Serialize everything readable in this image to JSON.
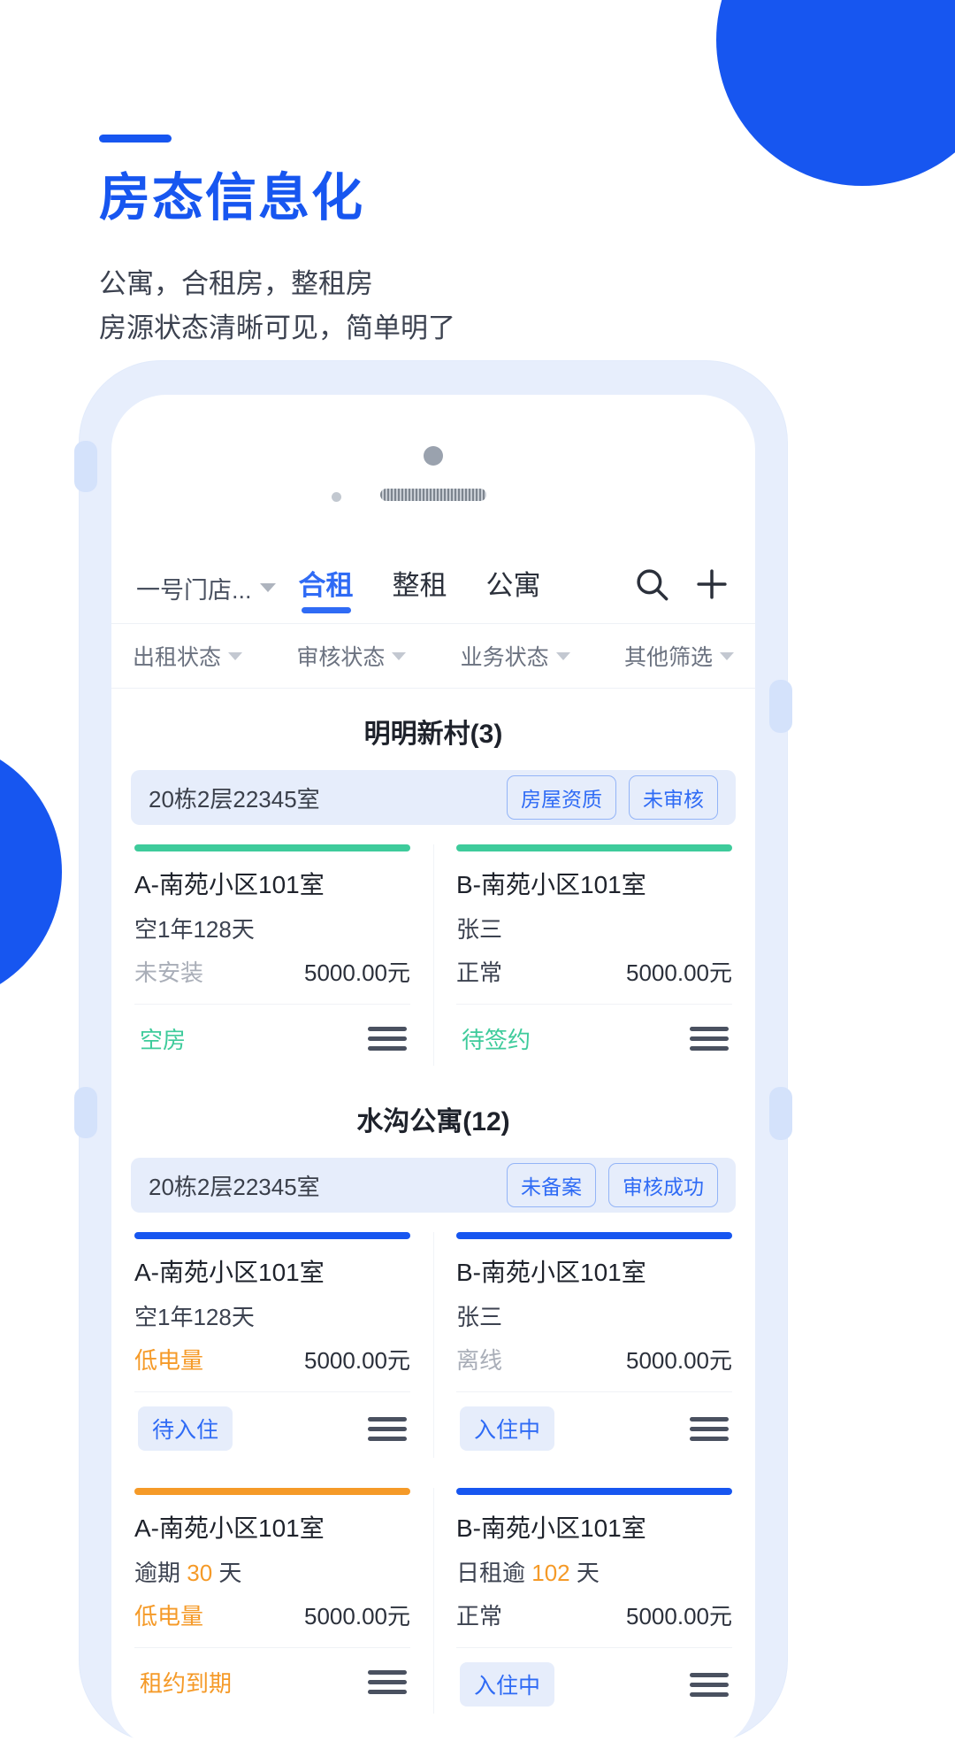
{
  "hero": {
    "title": "房态信息化",
    "subtitle_line1": "公寓，合租房，整租房",
    "subtitle_line2": "房源状态清晰可见，简单明了",
    "accent_color": "#1756f0"
  },
  "app": {
    "store_selector": "一号门店...",
    "tabs": [
      {
        "label": "合租",
        "active": true
      },
      {
        "label": "整租",
        "active": false
      },
      {
        "label": "公寓",
        "active": false
      }
    ],
    "icons": {
      "search": "search-icon",
      "add": "plus-icon"
    },
    "filters": [
      "出租状态",
      "审核状态",
      "业务状态",
      "其他筛选"
    ],
    "groups": [
      {
        "title": "明明新村(3)",
        "address": "20栋2层22345室",
        "address_badges": [
          "房屋资质",
          "未审核"
        ],
        "rows": [
          {
            "cells": [
              {
                "bar_color": "#3ecb9b",
                "title": "A-南苑小区101室",
                "meta": "空1年128天",
                "meta_highlight": "",
                "state": "未安装",
                "state_color": "#a9aeb8",
                "price": "5000.00元",
                "action_label": "空房",
                "action_color": "#3ecb9b",
                "action_style": "text"
              },
              {
                "bar_color": "#3ecb9b",
                "title": "B-南苑小区101室",
                "meta": "张三",
                "meta_highlight": "",
                "state": "正常",
                "state_color": "#3c4250",
                "price": "5000.00元",
                "action_label": "待签约",
                "action_color": "#3ecb9b",
                "action_style": "text"
              }
            ]
          }
        ]
      },
      {
        "title": "水沟公寓(12)",
        "address": "20栋2层22345室",
        "address_badges": [
          "未备案",
          "审核成功"
        ],
        "rows": [
          {
            "cells": [
              {
                "bar_color": "#1756f0",
                "title": "A-南苑小区101室",
                "meta": "空1年128天",
                "meta_highlight": "",
                "state": "低电量",
                "state_color": "#f59a28",
                "price": "5000.00元",
                "action_label": "待入住",
                "action_color": "#2f6bf5",
                "action_style": "chip"
              },
              {
                "bar_color": "#1756f0",
                "title": "B-南苑小区101室",
                "meta": "张三",
                "meta_highlight": "",
                "state": "离线",
                "state_color": "#a9aeb8",
                "price": "5000.00元",
                "action_label": "入住中",
                "action_color": "#2f6bf5",
                "action_style": "chip"
              }
            ]
          },
          {
            "cells": [
              {
                "bar_color": "#f59a28",
                "title": "A-南苑小区101室",
                "meta_pre": "逾期 ",
                "meta_highlight": "30",
                "meta_post": " 天",
                "state": "低电量",
                "state_color": "#f59a28",
                "price": "5000.00元",
                "action_label": "租约到期",
                "action_color": "#f59a28",
                "action_style": "text"
              },
              {
                "bar_color": "#1756f0",
                "title": "B-南苑小区101室",
                "meta_pre": "日租逾 ",
                "meta_highlight": "102",
                "meta_post": " 天",
                "state": "正常",
                "state_color": "#3c4250",
                "price": "5000.00元",
                "action_label": "入住中",
                "action_color": "#2f6bf5",
                "action_style": "chip"
              }
            ]
          }
        ]
      }
    ]
  }
}
